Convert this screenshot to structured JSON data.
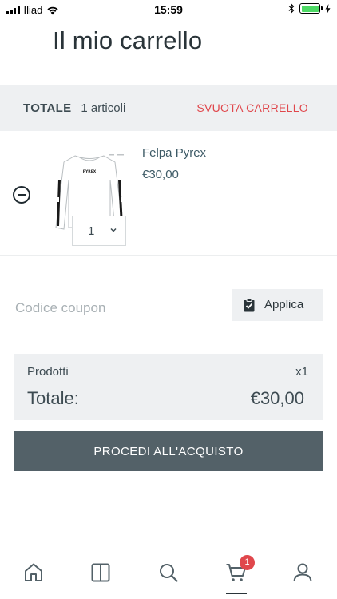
{
  "status_bar": {
    "carrier": "Iliad",
    "time": "15:59",
    "battery_color": "#4cd964"
  },
  "page": {
    "title": "Il mio carrello"
  },
  "cart_header": {
    "total_label": "TOTALE",
    "items_count": "1 articoli",
    "empty_cart_label": "SVUOTA CARRELLO"
  },
  "cart_items": [
    {
      "name": "Felpa Pyrex",
      "price": "€30,00",
      "quantity": "1",
      "image_text": "PYREX",
      "image_icon": "white-sweatshirt-image"
    }
  ],
  "coupon": {
    "placeholder": "Codice coupon",
    "value": "",
    "apply_label": "Applica",
    "apply_icon": "clipboard-check-icon"
  },
  "summary": {
    "products_label": "Prodotti",
    "products_qty": "x1",
    "total_label": "Totale:",
    "total_value": "€30,00"
  },
  "checkout": {
    "label": "PROCEDI ALL'ACQUISTO"
  },
  "tab_bar": {
    "tabs": [
      {
        "icon": "home-icon"
      },
      {
        "icon": "catalog-icon"
      },
      {
        "icon": "search-icon"
      },
      {
        "icon": "cart-icon",
        "badge": "1",
        "active": true
      },
      {
        "icon": "user-icon"
      }
    ]
  },
  "colors": {
    "accent_red": "#e0474c",
    "button_dark": "#536168",
    "panel_gray": "#eef0f2",
    "text_dark": "#3d4b52"
  }
}
